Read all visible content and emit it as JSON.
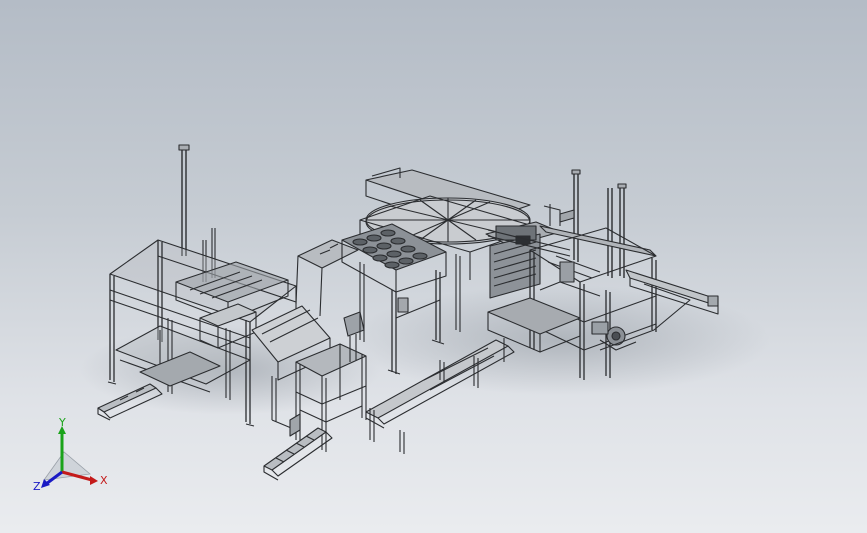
{
  "view": {
    "background_top": "#b4bcc6",
    "background_bottom": "#eaecef",
    "model_line_color": "#2b2d30",
    "model_face_color": "#a9adb2"
  },
  "triad": {
    "x_label": "X",
    "y_label": "Y",
    "z_label": "Z",
    "x_color": "#c41a1a",
    "y_color": "#1aa31a",
    "z_color": "#1a1ac4"
  }
}
